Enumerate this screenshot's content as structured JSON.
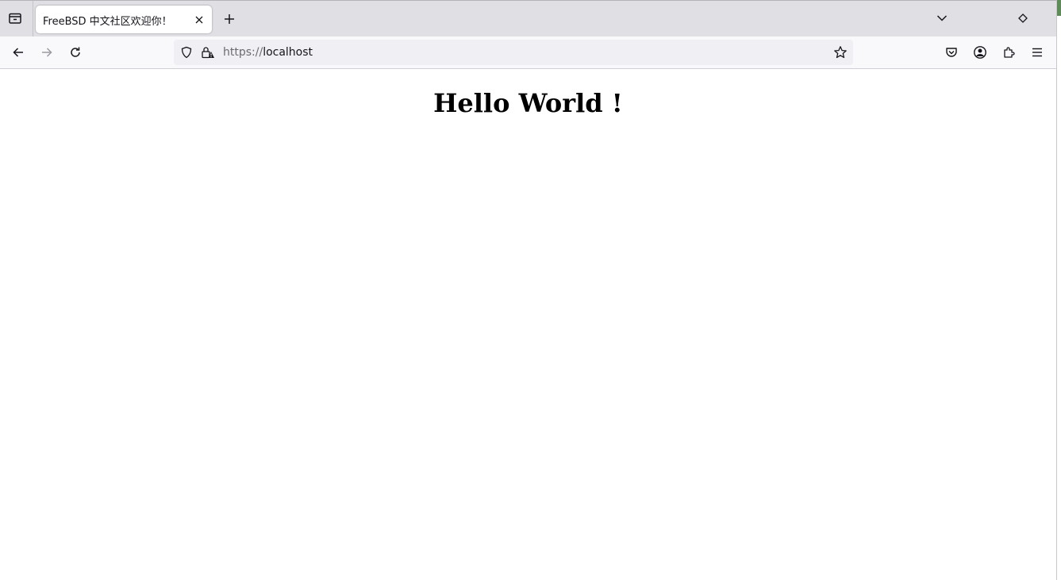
{
  "browser": {
    "tabs": [
      {
        "title": "FreeBSD 中文社区欢迎你！",
        "active": true
      }
    ],
    "address_bar": {
      "scheme": "https://",
      "host": "localhost"
    },
    "icons": {
      "tab_overview": "tab-overview-icon",
      "tab_close": "close-icon",
      "new_tab": "plus-icon",
      "list_all_tabs": "chevron-down-icon",
      "extra": "diamond-icon",
      "back": "back-arrow-icon",
      "forward": "forward-arrow-icon",
      "reload": "reload-icon",
      "tracking_protection": "shield-icon",
      "connection_security": "lock-warning-icon",
      "bookmark": "star-icon",
      "pocket": "pocket-icon",
      "account": "account-icon",
      "extensions": "puzzle-icon",
      "menu": "hamburger-menu-icon"
    },
    "colors": {
      "tabstrip_bg": "#e0e0e4",
      "toolbar_bg": "#f9f9fb",
      "urlbar_bg": "#f0f0f4",
      "text": "#15141a"
    }
  },
  "page": {
    "heading": "Hello World !"
  }
}
